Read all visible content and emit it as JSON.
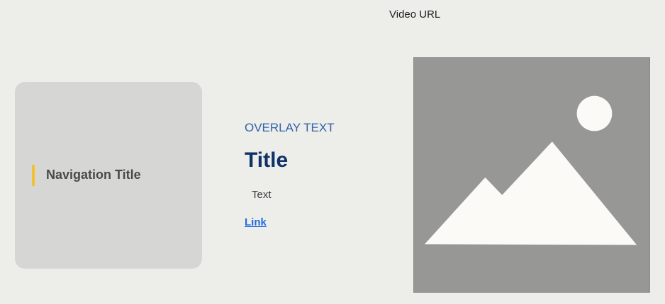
{
  "header": {
    "video_url_label": "Video URL"
  },
  "navigation_card": {
    "title": "Navigation Title",
    "accent_color": "#f2c233"
  },
  "content": {
    "overlay_text": "OVERLAY TEXT",
    "title": "Title",
    "text": "Text",
    "link_label": "Link"
  },
  "media": {
    "icon": "image-placeholder-icon"
  },
  "colors": {
    "background": "#ededea",
    "card": "#d6d6d5",
    "overlay_text": "#2e64a8",
    "title": "#0f3366",
    "link": "#1d6ce0",
    "placeholder": "#979796"
  }
}
